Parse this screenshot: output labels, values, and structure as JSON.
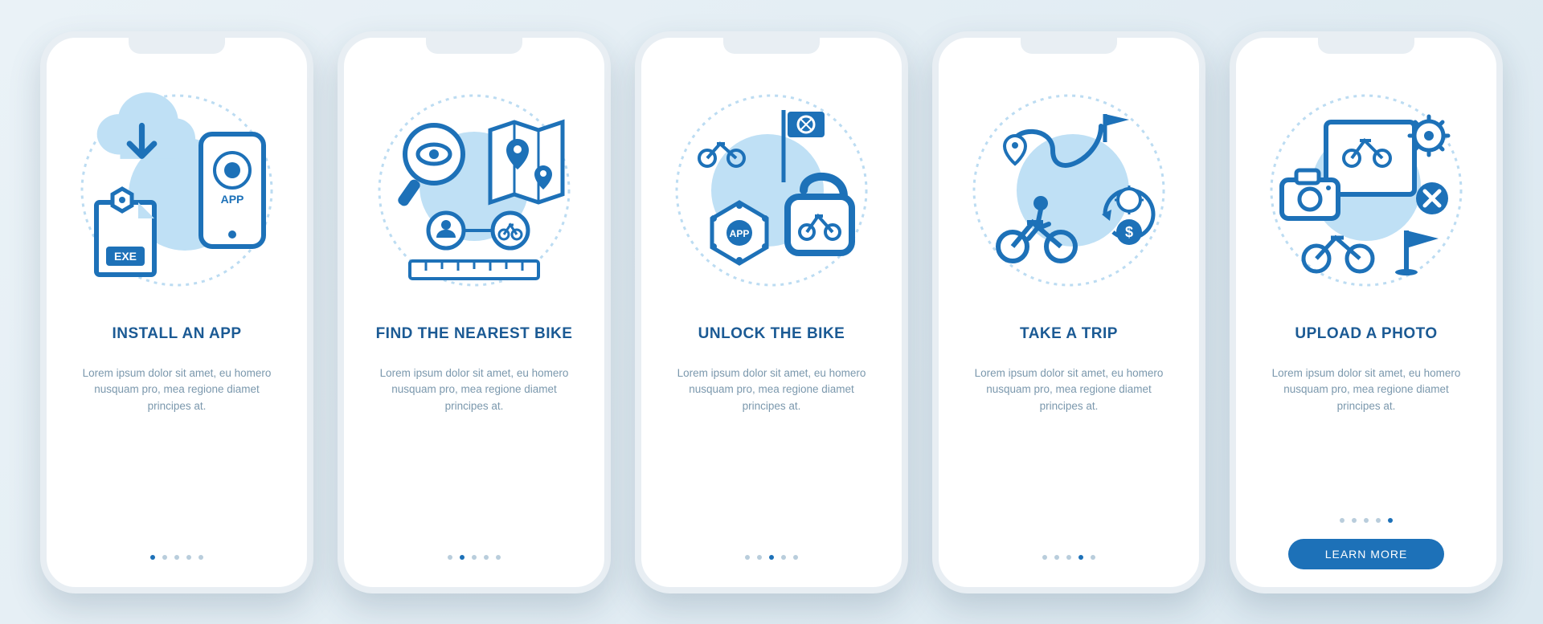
{
  "accent": "#1d71b8",
  "cta_label": "LEARN MORE",
  "slides": [
    {
      "title": "INSTALL AN APP",
      "desc": "Lorem ipsum dolor sit amet, eu homero nusquam pro, mea regione diamet principes at.",
      "active_index": 0,
      "icon": "install-app-icon",
      "has_cta": false
    },
    {
      "title": "FIND THE NEAREST BIKE",
      "desc": "Lorem ipsum dolor sit amet, eu homero nusquam pro, mea regione diamet principes at.",
      "active_index": 1,
      "icon": "find-bike-icon",
      "has_cta": false
    },
    {
      "title": "UNLOCK THE BIKE",
      "desc": "Lorem ipsum dolor sit amet, eu homero nusquam pro, mea regione diamet principes at.",
      "active_index": 2,
      "icon": "unlock-bike-icon",
      "has_cta": false
    },
    {
      "title": "TAKE A TRIP",
      "desc": "Lorem ipsum dolor sit amet, eu homero nusquam pro, mea regione diamet principes at.",
      "active_index": 3,
      "icon": "take-trip-icon",
      "has_cta": false
    },
    {
      "title": "UPLOAD A PHOTO",
      "desc": "Lorem ipsum dolor sit amet, eu homero nusquam pro, mea regione diamet principes at.",
      "active_index": 4,
      "icon": "upload-photo-icon",
      "has_cta": true
    }
  ],
  "dot_count": 5
}
